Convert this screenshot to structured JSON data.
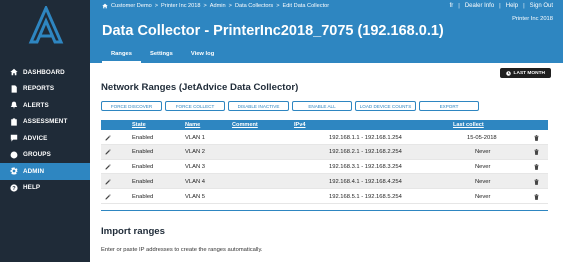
{
  "sidebar": {
    "items": [
      {
        "label": "DASHBOARD",
        "icon": "home-icon",
        "active": false
      },
      {
        "label": "REPORTS",
        "icon": "document-icon",
        "active": false
      },
      {
        "label": "ALERTS",
        "icon": "bell-icon",
        "active": false
      },
      {
        "label": "ASSESSMENT",
        "icon": "clipboard-icon",
        "active": false
      },
      {
        "label": "ADVICE",
        "icon": "chat-icon",
        "active": false
      },
      {
        "label": "GROUPS",
        "icon": "groups-icon",
        "active": false
      },
      {
        "label": "ADMIN",
        "icon": "gear-icon",
        "active": true
      },
      {
        "label": "HELP",
        "icon": "help-icon",
        "active": false
      }
    ]
  },
  "header": {
    "breadcrumb": [
      "Customer Demo",
      ">",
      "Printer Inc 2018",
      ">",
      "Admin",
      ">",
      "Data Collectors",
      ">",
      "Edit Data Collector"
    ],
    "topnav": [
      "fr",
      "|",
      "Dealer Info",
      "|",
      "Help",
      "|",
      "Sign Out"
    ],
    "org_name": "Printer Inc 2018",
    "title": "Data Collector - PrinterInc2018_7075 (192.168.0.1)",
    "tabs": [
      {
        "label": "Ranges",
        "active": true
      },
      {
        "label": "Settings",
        "active": false
      },
      {
        "label": "View log",
        "active": false
      }
    ]
  },
  "main": {
    "period_button": "LAST MONTH",
    "section_title": "Network Ranges (JetAdvice Data Collector)",
    "actions": [
      "FORCE DISCOVER",
      "FORCE COLLECT",
      "DISABLE INACTIVE",
      "ENABLE ALL",
      "LOAD DEVICE COUNTS",
      "EXPORT"
    ],
    "columns": [
      "State",
      "Name",
      "Comment",
      "IPv4",
      "Last collect"
    ],
    "rows": [
      {
        "state": "Enabled",
        "name": "VLAN 1",
        "comment": "",
        "ipv4": "192.168.1.1 -   192.168.1.254",
        "last_collect": "15-05-2018"
      },
      {
        "state": "Enabled",
        "name": "VLAN 2",
        "comment": "",
        "ipv4": "192.168.2.1 -   192.168.2.254",
        "last_collect": "Never"
      },
      {
        "state": "Enabled",
        "name": "VLAN 3",
        "comment": "",
        "ipv4": "192.168.3.1 -   192.168.3.254",
        "last_collect": "Never"
      },
      {
        "state": "Enabled",
        "name": "VLAN 4",
        "comment": "",
        "ipv4": "192.168.4.1 -   192.168.4.254",
        "last_collect": "Never"
      },
      {
        "state": "Enabled",
        "name": "VLAN 5",
        "comment": "",
        "ipv4": "192.168.5.1 -   192.168.5.254",
        "last_collect": "Never"
      }
    ],
    "import_title": "Import ranges",
    "import_hint": "Enter or paste IP addresses to create the ranges automatically."
  },
  "colors": {
    "accent": "#2e86c1",
    "sidebar": "#1f2b38",
    "row_alt": "#eeeeee"
  }
}
